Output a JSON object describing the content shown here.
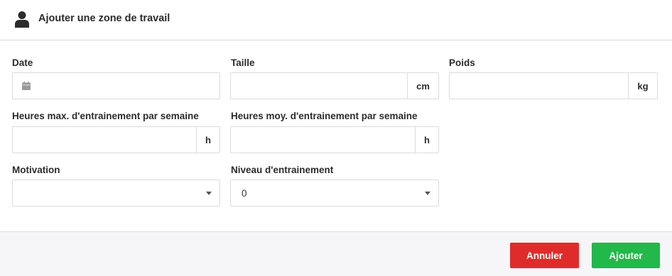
{
  "header": {
    "title": "Ajouter une zone de travail",
    "icon": "user-icon"
  },
  "form": {
    "date": {
      "label": "Date",
      "value": "",
      "icon": "calendar-icon"
    },
    "taille": {
      "label": "Taille",
      "value": "",
      "unit": "cm"
    },
    "poids": {
      "label": "Poids",
      "value": "",
      "unit": "kg"
    },
    "heures_max": {
      "label": "Heures max. d'entrainement par semaine",
      "value": "",
      "unit": "h"
    },
    "heures_moy": {
      "label": "Heures moy. d'entrainement par semaine",
      "value": "",
      "unit": "h"
    },
    "motivation": {
      "label": "Motivation",
      "value": ""
    },
    "niveau": {
      "label": "Niveau d'entrainement",
      "value": "0"
    }
  },
  "footer": {
    "cancel_label": "Annuler",
    "submit_label": "Ajouter"
  },
  "colors": {
    "cancel": "#e02b2b",
    "submit": "#22b84a",
    "footer_bg": "#f6f6f8"
  }
}
